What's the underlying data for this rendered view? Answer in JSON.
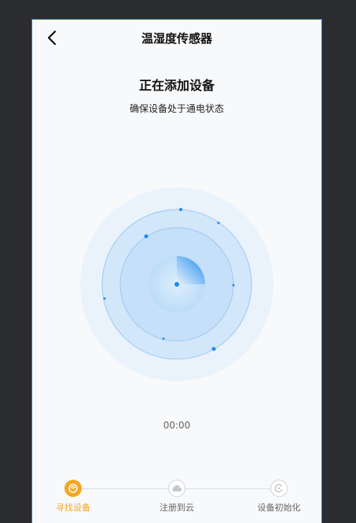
{
  "header": {
    "title": "温湿度传感器"
  },
  "main": {
    "title": "正在添加设备",
    "subtitle": "确保设备处于通电状态",
    "timer": "00:00"
  },
  "steps": [
    {
      "label": "寻找设备",
      "state": "active",
      "icon": "search-device-icon"
    },
    {
      "label": "注册到云",
      "state": "inactive",
      "icon": "cloud-icon"
    },
    {
      "label": "设备初始化",
      "state": "inactive",
      "icon": "refresh-icon"
    }
  ],
  "colors": {
    "accent": "#f5a623",
    "radar_blue": "#1e8bef",
    "background": "#f8f9fb"
  }
}
